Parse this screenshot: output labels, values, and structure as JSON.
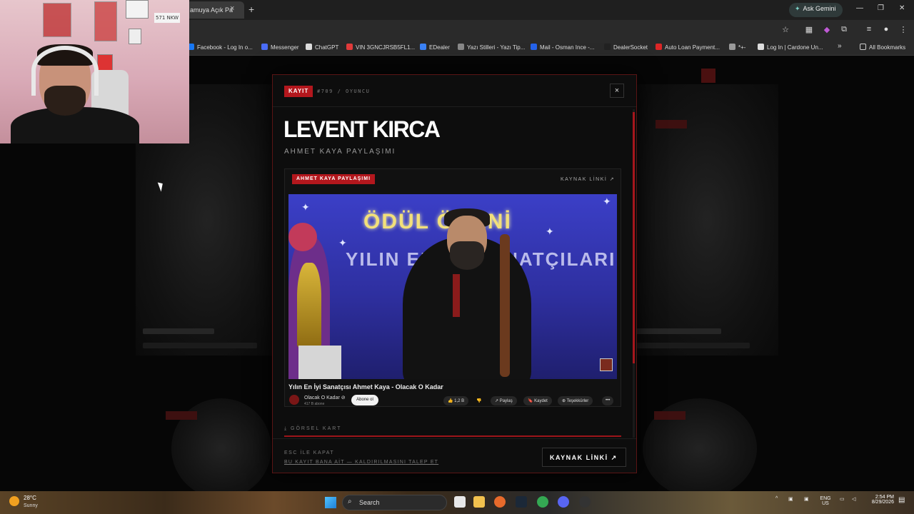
{
  "browser": {
    "tab_title": "amuya Açık Pa",
    "tab_close": "×",
    "tab_new": "+",
    "gemini_label": "Ask Gemini",
    "window_min": "—",
    "window_max": "❐",
    "window_close": "✕",
    "bookmarks": [
      {
        "label": "Facebook - Log In o...",
        "icon_color": "#1877f2"
      },
      {
        "label": "Messenger",
        "icon_color": "#4a6cf7"
      },
      {
        "label": "ChatGPT",
        "icon_color": "#dddddd"
      },
      {
        "label": "VIN 3GNCJRSB5FL1...",
        "icon_color": "#e23b3b"
      },
      {
        "label": "EDealer",
        "icon_color": "#3b82f6"
      },
      {
        "label": "Yazı Stilleri - Yazı Tip...",
        "icon_color": "#888888"
      },
      {
        "label": "Mail - Osman Ince -...",
        "icon_color": "#2563eb"
      },
      {
        "label": "DealerSocket",
        "icon_color": "#222222"
      },
      {
        "label": "Auto Loan Payment...",
        "icon_color": "#dc2626"
      },
      {
        "label": "*+-",
        "icon_color": "#999999"
      },
      {
        "label": "Log In | Cardone Un...",
        "icon_color": "#dddddd"
      }
    ],
    "bookmarks_more": "»",
    "all_bookmarks": "All Bookmarks"
  },
  "webcam": {
    "wall_tag": "571 NKW"
  },
  "modal": {
    "badge": "KAYIT",
    "meta": "#709 / OYUNCU",
    "close": "×",
    "title": "LEVENT KIRCA",
    "subtitle": "AHMET KAYA PAYLAŞIMI",
    "embed": {
      "badge": "AHMET KAYA PAYLAŞIMI",
      "source_link": "KAYNAK LİNKİ ↗",
      "video_award_text": "ÖDÜL ÖRENİ",
      "video_band_text": "YILIN EN İYİ SANATÇILARI",
      "video_title": "Yılın En İyi Sanatçısı Ahmet Kaya - Olacak O Kadar",
      "channel_name": "Olacak O Kadar ⊘",
      "channel_subs": "417 B abone",
      "subscribe": "Abone ol",
      "likes": "👍 1,2 B",
      "dislike": "👎",
      "share": "↗ Paylaş",
      "save": "🔖 Kaydet",
      "thanks": "⊕ Teşekkürler",
      "more": "•••"
    },
    "gorsel_kart": "⤓ GÖRSEL KART",
    "footer": {
      "esc_hint": "ESC İLE KAPAT",
      "claim_link": "BU KAYIT BANA AİT — KALDIRILMASINI TALEP ET",
      "source_button": "KAYNAK LİNKİ  ↗"
    }
  },
  "taskbar": {
    "temperature": "28°C",
    "condition": "Sunny",
    "search_placeholder": "Search",
    "lang_top": "ENG",
    "lang_bottom": "US",
    "time": "2:54 PM",
    "date": "8/29/2026"
  }
}
